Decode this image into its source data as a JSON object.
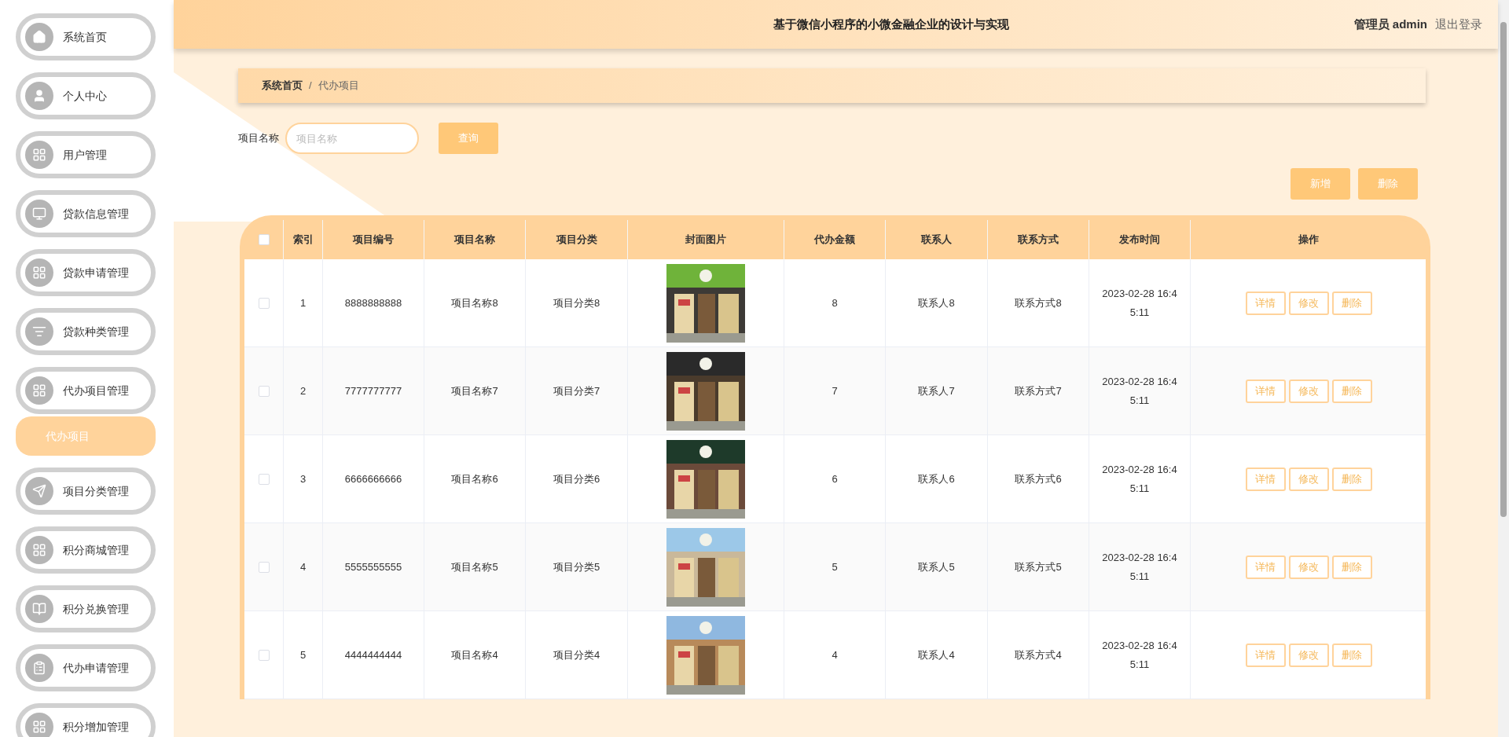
{
  "sidebar": {
    "items": [
      {
        "label": "系统首页",
        "selected": false
      },
      {
        "label": "个人中心",
        "selected": false
      },
      {
        "label": "用户管理",
        "selected": false
      },
      {
        "label": "贷款信息管理",
        "selected": false
      },
      {
        "label": "贷款申请管理",
        "selected": false
      },
      {
        "label": "贷款种类管理",
        "selected": false
      },
      {
        "label": "代办项目管理",
        "selected": false,
        "children": [
          {
            "label": "代办项目",
            "selected": true
          }
        ]
      },
      {
        "label": "项目分类管理",
        "selected": false
      },
      {
        "label": "积分商城管理",
        "selected": false
      },
      {
        "label": "积分兑换管理",
        "selected": false
      },
      {
        "label": "代办申请管理",
        "selected": false
      },
      {
        "label": "积分增加管理",
        "selected": false
      }
    ]
  },
  "header": {
    "title": "基于微信小程序的小微金融企业的设计与实现",
    "user": "管理员 admin",
    "logout": "退出登录"
  },
  "breadcrumb": {
    "items": [
      "系统首页",
      "代办项目"
    ],
    "separator": "/"
  },
  "search": {
    "label": "项目名称",
    "placeholder": "项目名称",
    "button": "查询"
  },
  "actions": [
    "新增",
    "删除"
  ],
  "table": {
    "select_all_checked": false,
    "columns": [
      "索引",
      "项目编号",
      "项目名称",
      "项目分类",
      "封面图片",
      "代办金额",
      "联系人",
      "联系方式",
      "发布时间",
      "操作"
    ],
    "rows": [
      {
        "checked": false,
        "cells": [
          "1",
          "8888888888",
          "项目名称8",
          "项目分类8",
          {
            "kind": "picture"
          },
          "8",
          "联系人8",
          "联系方式8",
          "2023-02-28 16:45:11",
          {
            "buttons": [
              "详情",
              "修改",
              "删除"
            ]
          }
        ]
      },
      {
        "checked": false,
        "cells": [
          "2",
          "7777777777",
          "项目名称7",
          "项目分类7",
          {
            "kind": "picture"
          },
          "7",
          "联系人7",
          "联系方式7",
          "2023-02-28 16:45:11",
          {
            "buttons": [
              "详情",
              "修改",
              "删除"
            ]
          }
        ]
      },
      {
        "checked": false,
        "cells": [
          "3",
          "6666666666",
          "项目名称6",
          "项目分类6",
          {
            "kind": "picture"
          },
          "6",
          "联系人6",
          "联系方式6",
          "2023-02-28 16:45:11",
          {
            "buttons": [
              "详情",
              "修改",
              "删除"
            ]
          }
        ]
      },
      {
        "checked": false,
        "cells": [
          "4",
          "5555555555",
          "项目名称5",
          "项目分类5",
          {
            "kind": "picture"
          },
          "5",
          "联系人5",
          "联系方式5",
          "2023-02-28 16:45:11",
          {
            "buttons": [
              "详情",
              "修改",
              "删除"
            ]
          }
        ]
      },
      {
        "checked": false,
        "cells": [
          "5",
          "4444444444",
          "项目名称4",
          "项目分类4",
          {
            "kind": "picture"
          },
          "4",
          "联系人4",
          "联系方式4",
          "2023-02-28 16:45:11",
          {
            "buttons": [
              "详情",
              "修改",
              "删除"
            ]
          }
        ]
      }
    ]
  }
}
